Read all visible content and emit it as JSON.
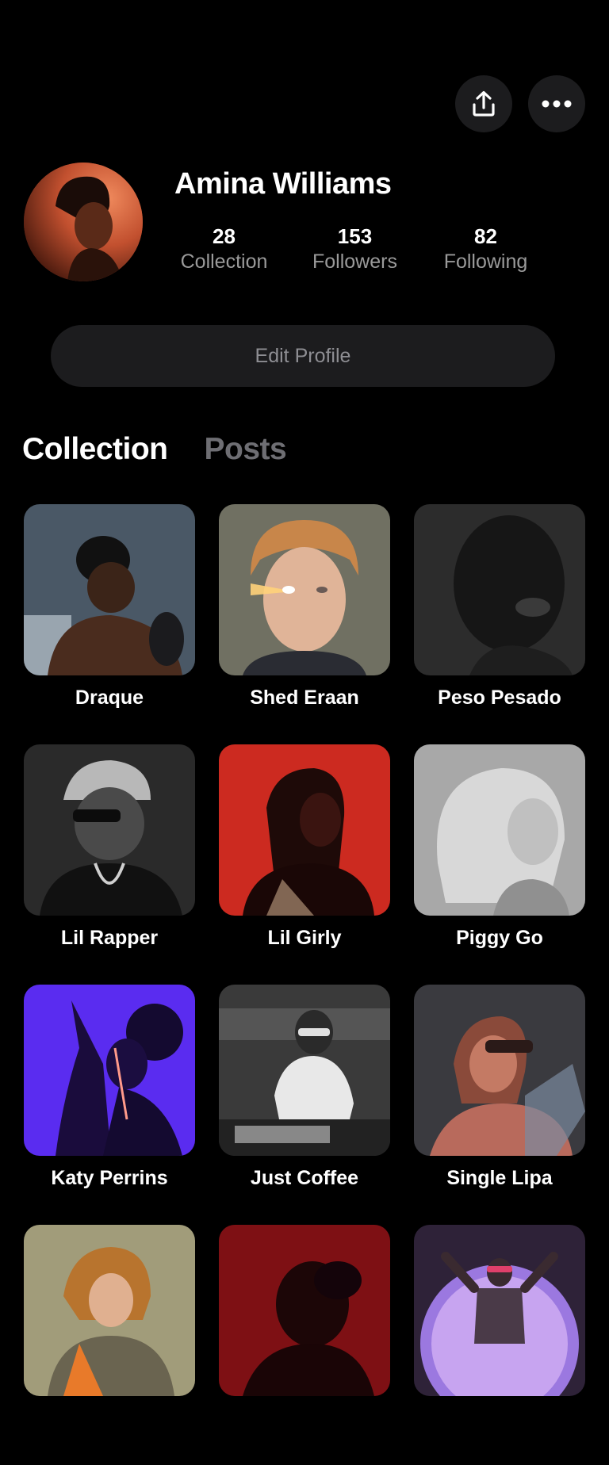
{
  "header": {
    "share_icon": "share-upload-icon",
    "more_icon": "more-horizontal-icon"
  },
  "profile": {
    "name": "Amina Williams",
    "stats": [
      {
        "value": "28",
        "label": "Collection"
      },
      {
        "value": "153",
        "label": "Followers"
      },
      {
        "value": "82",
        "label": "Following"
      }
    ],
    "edit_label": "Edit Profile"
  },
  "tabs": [
    {
      "label": "Collection",
      "active": true
    },
    {
      "label": "Posts",
      "active": false
    }
  ],
  "collection": [
    {
      "name": "Draque",
      "bg": "#3e4a55",
      "accent": "#1b1d20"
    },
    {
      "name": "Shed Eraan",
      "bg": "#6f7061",
      "accent": "#d6a888"
    },
    {
      "name": "Peso Pesado",
      "bg": "#2b2b2b",
      "accent": "#141414"
    },
    {
      "name": "Lil Rapper",
      "bg": "#2a2a2a",
      "accent": "#9a9a9a"
    },
    {
      "name": "Lil Girly",
      "bg": "#c8281e",
      "accent": "#2a0b08"
    },
    {
      "name": "Piggy Go",
      "bg": "#9c9c9c",
      "accent": "#cfcfcf"
    },
    {
      "name": "Katy Perrins",
      "bg": "#5b2bf2",
      "accent": "#160a3a"
    },
    {
      "name": "Just Coffee",
      "bg": "#3a3a3a",
      "accent": "#d8d8d8"
    },
    {
      "name": "Single Lipa",
      "bg": "#3b3b40",
      "accent": "#c4695a"
    },
    {
      "name": "",
      "bg": "#a09a78",
      "accent": "#c46a2a"
    },
    {
      "name": "",
      "bg": "#7a0f12",
      "accent": "#1a0506"
    },
    {
      "name": "",
      "bg": "#3b2a4a",
      "accent": "#c7a4f0"
    }
  ]
}
